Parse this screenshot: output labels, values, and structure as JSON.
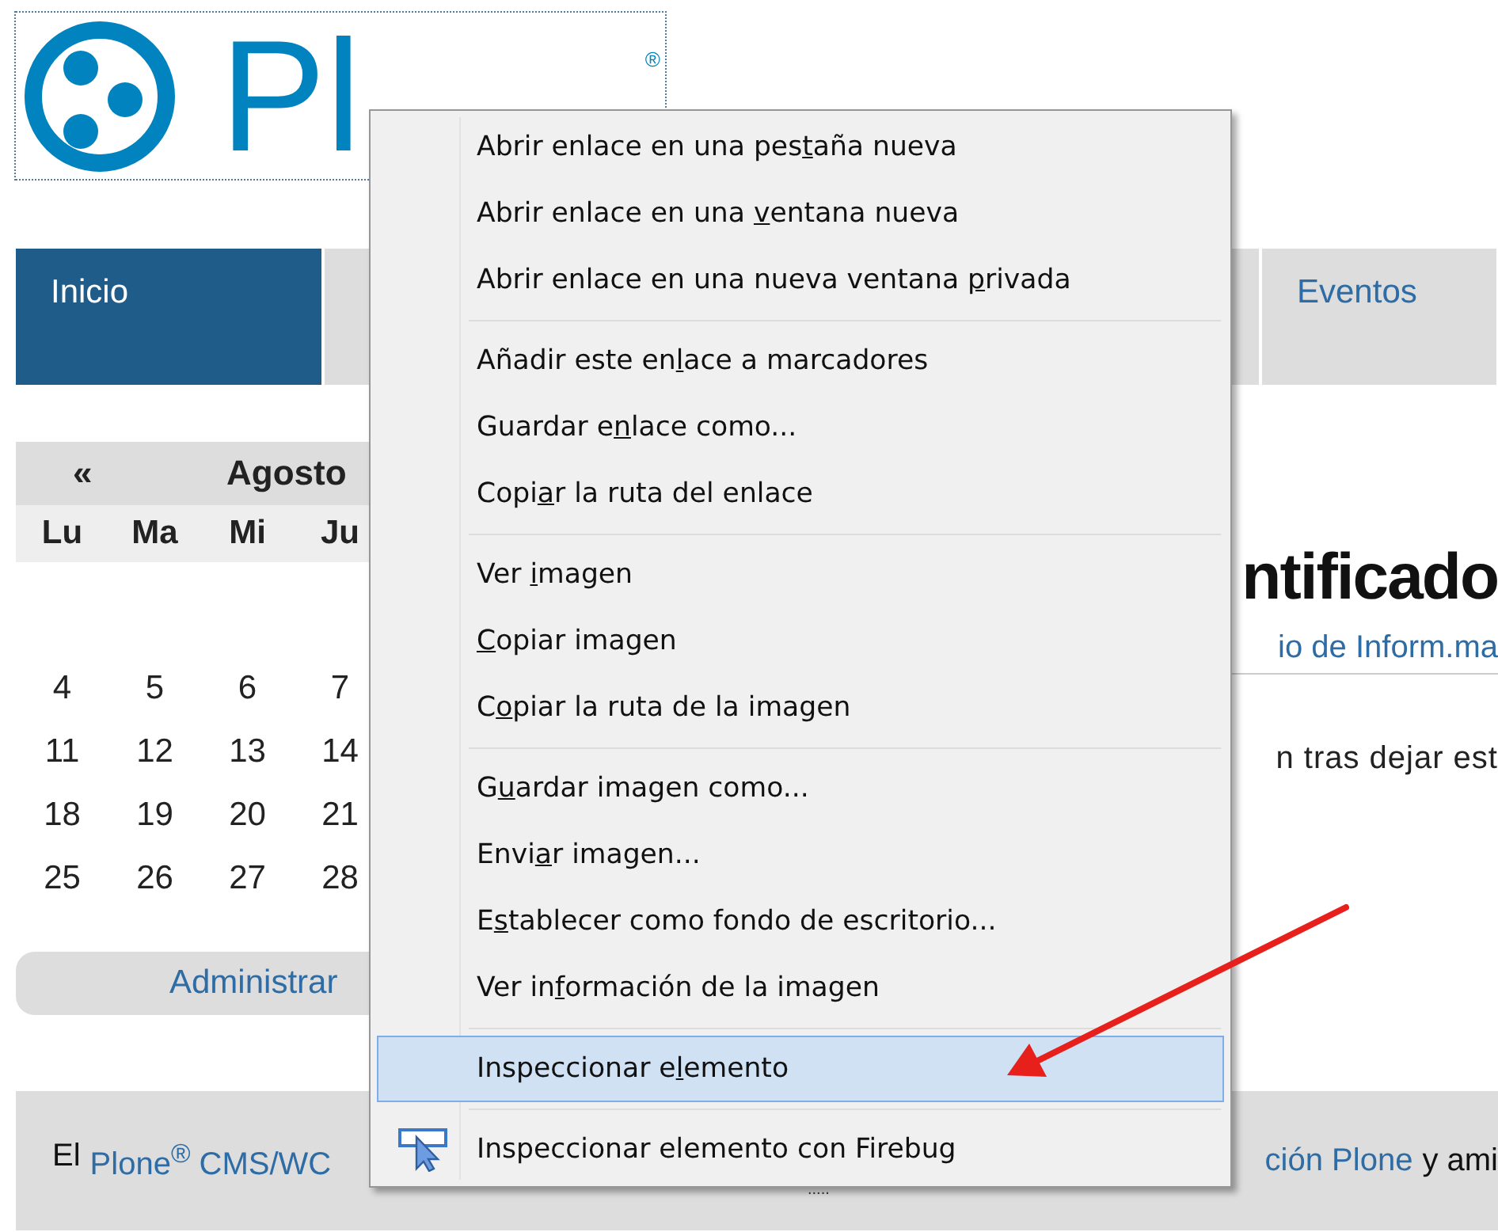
{
  "logo": {
    "text": "Pl",
    "mark": "®"
  },
  "nav_tabs": [
    {
      "label": "Inicio",
      "selected": true
    },
    {
      "selected": false
    },
    {
      "label": "Eventos",
      "selected": false
    }
  ],
  "calendar": {
    "prev": "«",
    "month": "Agosto",
    "weekdays": [
      "Lu",
      "Ma",
      "Mi",
      "Ju"
    ],
    "weeks": [
      [
        "4",
        "5",
        "6",
        "7"
      ],
      [
        "11",
        "12",
        "13",
        "14"
      ],
      [
        "18",
        "19",
        "20",
        "21"
      ],
      [
        "25",
        "26",
        "27",
        "28"
      ]
    ],
    "manage_button": "Administrar"
  },
  "content": {
    "heading": "ntificado",
    "byline": "io de Inform.ma",
    "text": "n tras dejar est"
  },
  "footer": {
    "left": [
      {
        "kind": "text",
        "text": "El"
      },
      {
        "kind": "link",
        "text": "Plone$^{®}$ CMS/WC"
      }
    ],
    "right": [
      {
        "kind": "link",
        "text": "ción Plone"
      },
      {
        "kind": "text",
        "text": "y ami"
      }
    ],
    "mark": "....."
  },
  "context_menu": {
    "groups": [
      [
        {
          "before": "Abrir enlace en una pes",
          "key": "t",
          "after": "aña nueva",
          "highlighted": false
        },
        {
          "before": "Abrir enlace en una ",
          "key": "v",
          "after": "entana nueva",
          "highlighted": false
        },
        {
          "before": "Abrir enlace en una nueva ventana ",
          "key": "p",
          "after": "rivada",
          "highlighted": false
        }
      ],
      [
        {
          "before": "Añadir este en",
          "key": "l",
          "after": "ace a marcadores",
          "highlighted": false
        },
        {
          "before": "Guardar e",
          "key": "n",
          "after": "lace como...",
          "highlighted": false
        },
        {
          "before": "Copi",
          "key": "a",
          "after": "r la ruta del enlace",
          "highlighted": false
        }
      ],
      [
        {
          "before": "Ver ",
          "key": "i",
          "after": "magen",
          "highlighted": false
        },
        {
          "key": "C",
          "after": "opiar imagen",
          "highlighted": false
        },
        {
          "before": "C",
          "key": "o",
          "after": "piar la ruta de la imagen",
          "highlighted": false
        }
      ],
      [
        {
          "before": "G",
          "key": "u",
          "after": "ardar imagen como...",
          "highlighted": false
        },
        {
          "before": "Envi",
          "key": "a",
          "after": "r imagen...",
          "highlighted": false
        },
        {
          "before": "E",
          "key": "s",
          "after": "tablecer como fondo de escritorio...",
          "highlighted": false
        },
        {
          "before": "Ver in",
          "key": "f",
          "after": "ormación de la imagen",
          "highlighted": false
        }
      ],
      [
        {
          "before": "Inspeccionar e",
          "key": "l",
          "after": "emento",
          "highlighted": true
        }
      ],
      [
        {
          "before": "Inspeccionar elemento con Firebug",
          "highlighted": false,
          "kind": "inspect"
        }
      ]
    ]
  }
}
